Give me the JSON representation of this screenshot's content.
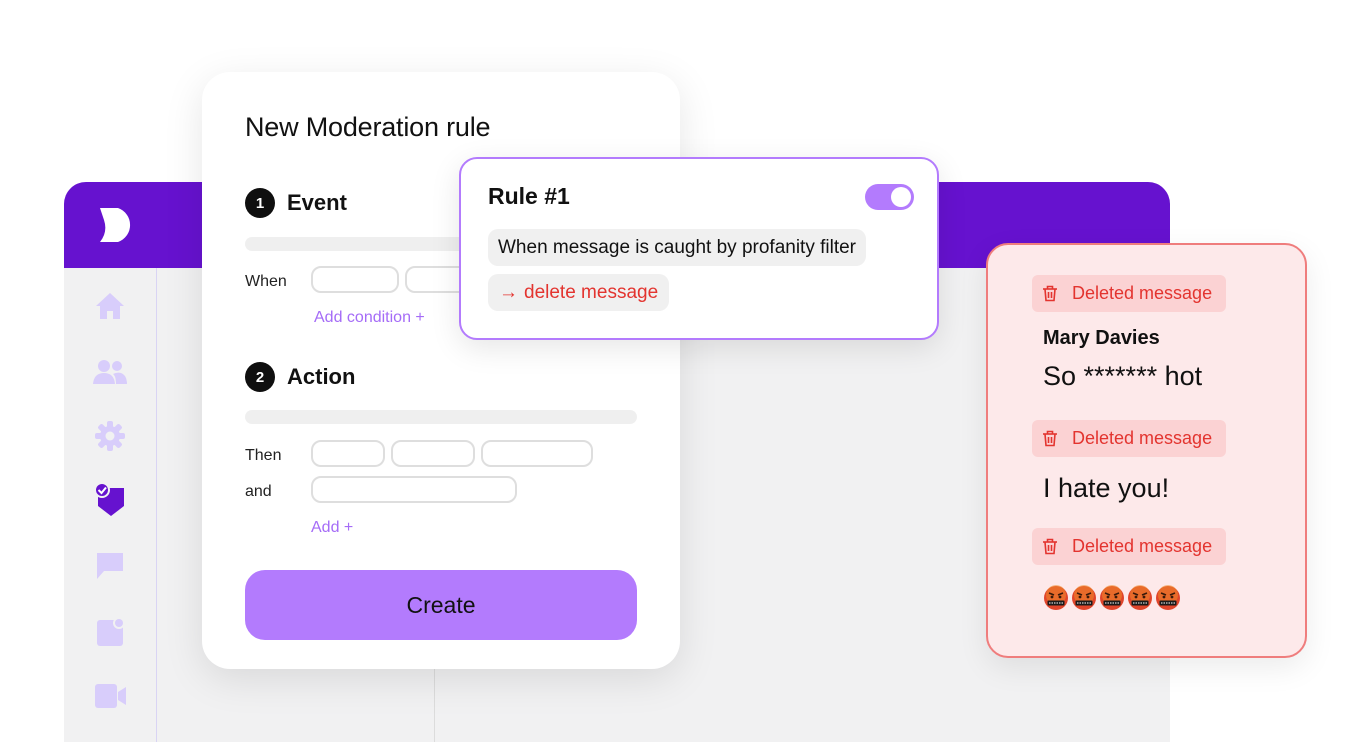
{
  "app": {
    "brand_color": "#6612cf",
    "accent_color": "#b37bfd",
    "sidebar_icons": [
      "home-icon",
      "users-icon",
      "gear-icon",
      "moderation-shield-icon",
      "chat-icon",
      "notification-icon",
      "video-icon"
    ],
    "active_sidebar_icon": "moderation-shield-icon"
  },
  "rule_form": {
    "title": "New Moderation rule",
    "event": {
      "number": "1",
      "label": "Event",
      "row_label": "When",
      "add_condition": "Add condition +"
    },
    "action": {
      "number": "2",
      "label": "Action",
      "then_label": "Then",
      "and_label": "and",
      "add_label": "Add +"
    },
    "create_label": "Create"
  },
  "rule_card": {
    "title": "Rule #1",
    "enabled": true,
    "condition": "When message is caught by profanity filter",
    "action_arrow": "→",
    "action": "delete message"
  },
  "messages": {
    "deleted_label": "Deleted message",
    "author": "Mary Davies",
    "items": [
      {
        "text": "So ******* hot"
      },
      {
        "text": "I hate you!"
      },
      {
        "emoji_count": 5,
        "emoji": "face-with-symbols-on-mouth"
      }
    ]
  }
}
